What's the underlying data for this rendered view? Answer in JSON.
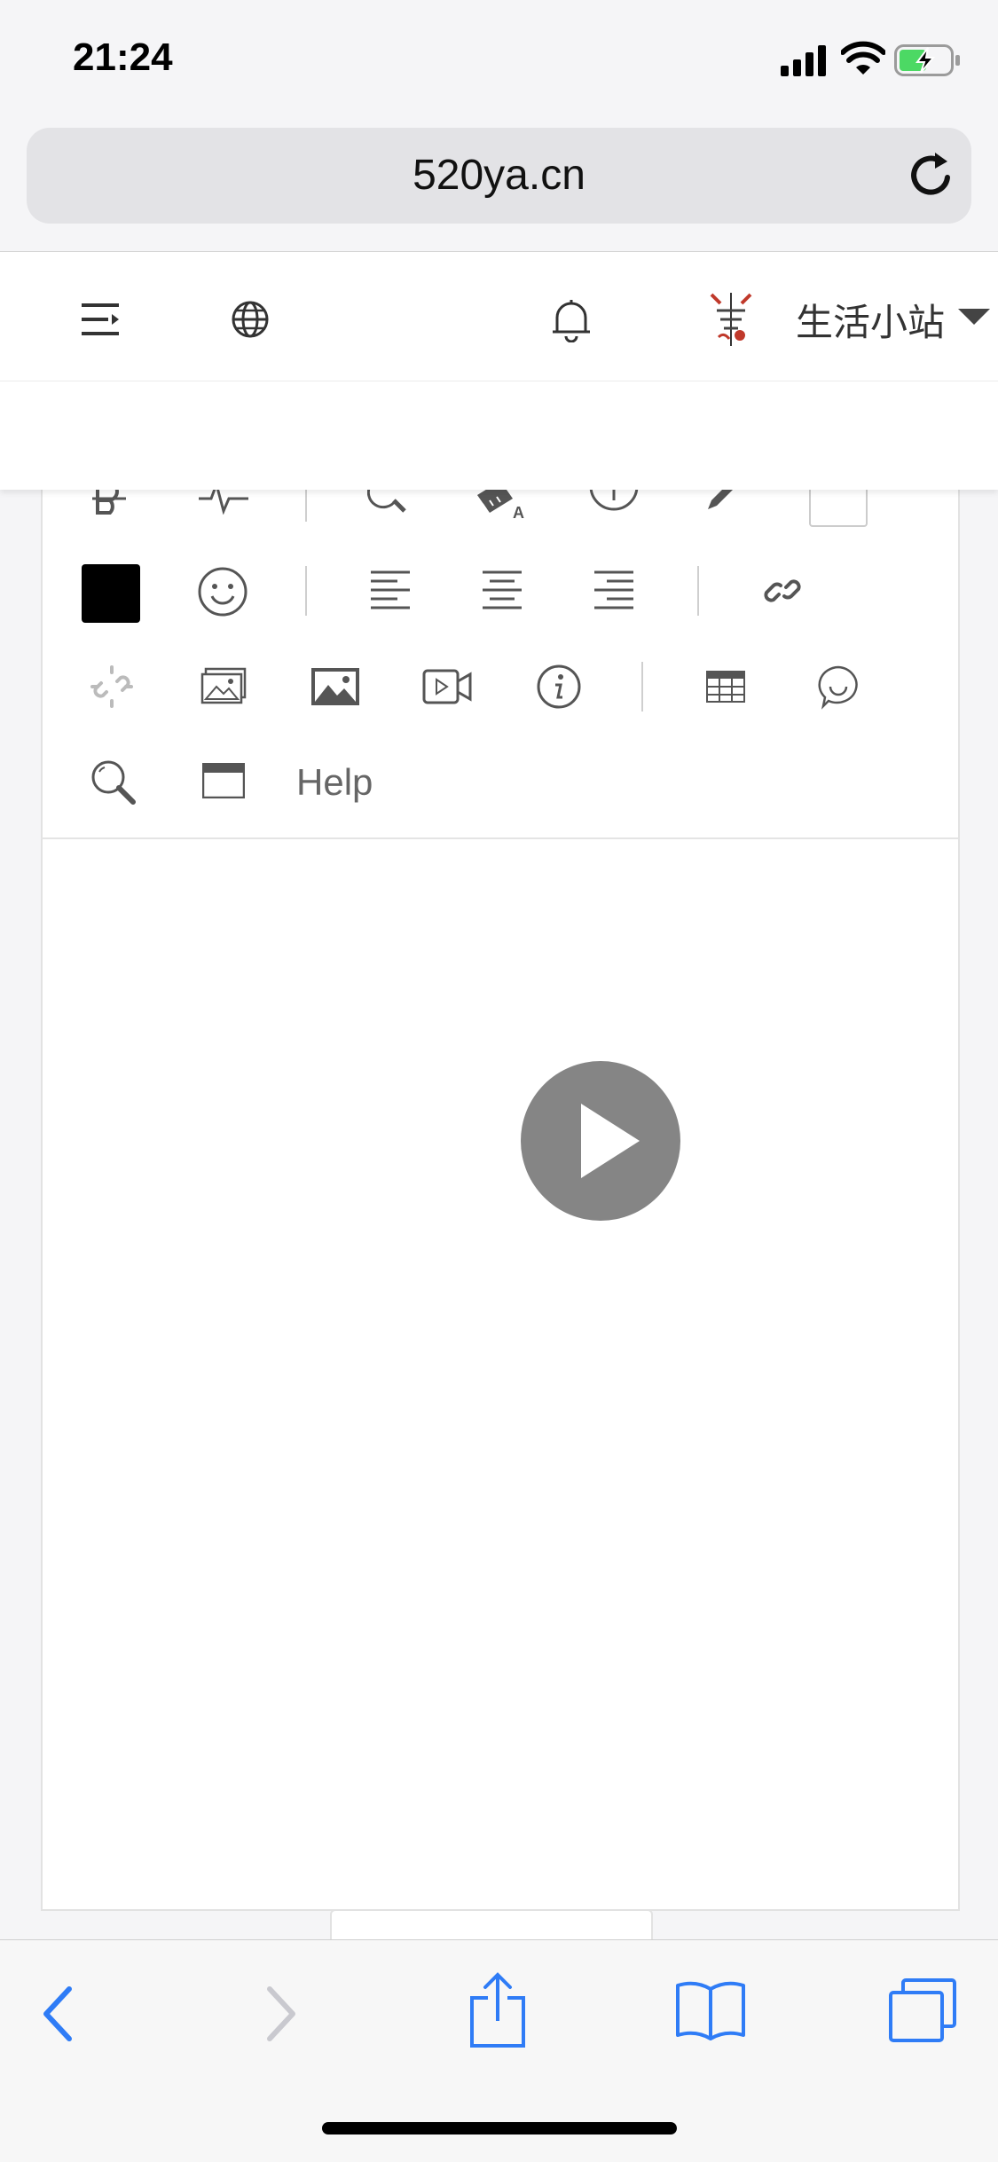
{
  "status_bar": {
    "time": "21:24"
  },
  "browser": {
    "url": "520ya.cn"
  },
  "site_header": {
    "site_name": "生活小站"
  },
  "editor": {
    "toolbar": {
      "help_label": "Help",
      "text_color": "#000000",
      "icons": [
        "strikethrough-icon",
        "wave-icon",
        "find-icon",
        "eraser-icon",
        "info-circle-icon",
        "pencil-icon",
        "color-swatch-icon",
        "text-color-swatch",
        "emoji-icon",
        "align-left-icon",
        "align-center-icon",
        "align-right-icon",
        "link-icon",
        "unlink-icon",
        "image-gallery-icon",
        "image-icon",
        "video-icon",
        "info-icon",
        "table-icon",
        "speech-bubble-icon",
        "search-icon",
        "fullscreen-icon"
      ]
    },
    "content": {
      "media": "video-play-button"
    }
  },
  "colors": {
    "accent": "#2f7cf6",
    "play_button": "#858585"
  }
}
